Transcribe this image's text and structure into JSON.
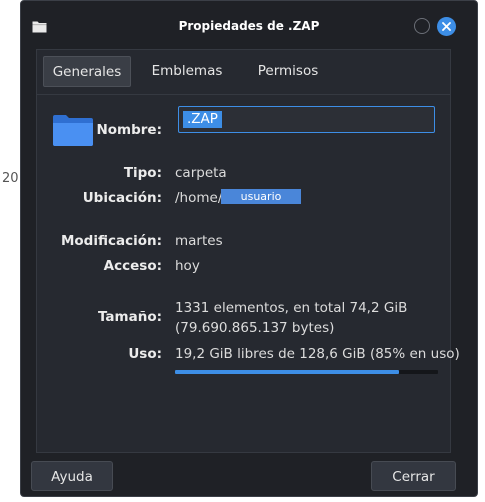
{
  "background_fragment": "20",
  "window": {
    "title": "Propiedades de .ZAP"
  },
  "tabs": [
    {
      "label": "Generales",
      "active": true
    },
    {
      "label": "Emblemas",
      "active": false
    },
    {
      "label": "Permisos",
      "active": false
    }
  ],
  "general": {
    "name_label": "Nombre:",
    "name_value": ".ZAP",
    "type_label": "Tipo:",
    "type_value": "carpeta",
    "location_label": "Ubicación:",
    "location_prefix": "/home/",
    "location_user": "usuario",
    "modified_label": "Modificación:",
    "modified_value": "martes",
    "accessed_label": "Acceso:",
    "accessed_value": "hoy",
    "size_label": "Tamaño:",
    "size_line1": "1331 elementos, en total 74,2 GiB",
    "size_line2": "(79.690.865.137 bytes)",
    "usage_label": "Uso:",
    "usage_value": "19,2 GiB libres de 128,6 GiB (85% en uso)",
    "usage_fraction": 0.85
  },
  "buttons": {
    "help": "Ayuda",
    "close": "Cerrar"
  },
  "icons": {
    "window": "folder-icon",
    "folder": "folder-icon",
    "minimize": "minimize-icon",
    "close": "close-icon"
  },
  "colors": {
    "accent": "#3d8ee6",
    "window_bg": "#1f2126",
    "pane_bg": "#262930"
  }
}
